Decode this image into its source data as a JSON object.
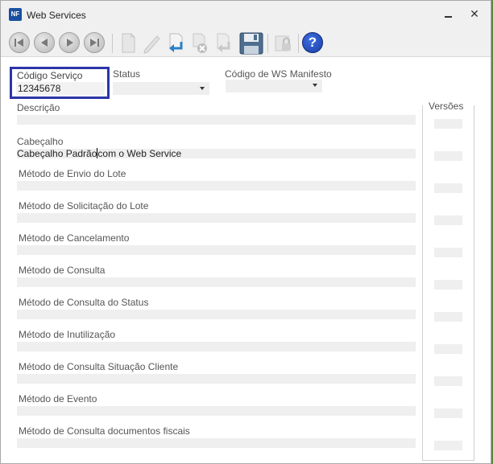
{
  "window": {
    "app_icon_text": "NF",
    "title": "Web Services",
    "minimize_label": "",
    "close_label": "✕"
  },
  "toolbar": {
    "buttons": [
      {
        "name": "first-record-button",
        "icon": "first-icon",
        "enabled": false
      },
      {
        "name": "previous-record-button",
        "icon": "previous-icon",
        "enabled": false
      },
      {
        "name": "next-record-button",
        "icon": "next-icon",
        "enabled": false
      },
      {
        "name": "last-record-button",
        "icon": "last-icon",
        "enabled": false
      },
      {
        "name": "new-button",
        "icon": "new-document-icon",
        "enabled": false
      },
      {
        "name": "edit-button",
        "icon": "pencil-icon",
        "enabled": false
      },
      {
        "name": "confirm-button",
        "icon": "confirm-arrow-icon",
        "enabled": true
      },
      {
        "name": "delete-button",
        "icon": "delete-icon",
        "enabled": false
      },
      {
        "name": "cancel-button",
        "icon": "cancel-arrow-icon",
        "enabled": false
      },
      {
        "name": "save-button",
        "icon": "floppy-disk-icon",
        "enabled": true
      },
      {
        "name": "lock-button",
        "icon": "lock-icon",
        "enabled": false
      },
      {
        "name": "help-button",
        "icon": "help-icon",
        "enabled": true
      }
    ],
    "help_glyph": "?"
  },
  "form": {
    "codigo_servico": {
      "label": "Código Serviço",
      "value": "12345678"
    },
    "status": {
      "label": "Status",
      "value": ""
    },
    "codigo_ws_manifesto": {
      "label": "Código de WS Manifesto",
      "value": ""
    },
    "descricao": {
      "label": "Descrição",
      "value": ""
    },
    "cabecalho": {
      "label": "Cabeçalho",
      "value_before_caret": "Cabeçalho Padrão",
      "value_after_caret": "com o Web Service"
    },
    "metodo_envio_lote": {
      "label": "Método de Envio do Lote",
      "value": ""
    },
    "metodo_solicitacao_lote": {
      "label": "Método de Solicitação do Lote",
      "value": ""
    },
    "metodo_cancelamento": {
      "label": "Método de Cancelamento",
      "value": ""
    },
    "metodo_consulta": {
      "label": "Método de Consulta",
      "value": ""
    },
    "metodo_consulta_status": {
      "label": "Método de Consulta do Status",
      "value": ""
    },
    "metodo_inutilizacao": {
      "label": "Método de Inutilização",
      "value": ""
    },
    "metodo_consulta_situacao_cliente": {
      "label": "Método de Consulta Situação Cliente",
      "value": ""
    },
    "metodo_evento": {
      "label": "Método de Evento",
      "value": ""
    },
    "metodo_consulta_documentos_fiscais": {
      "label": "Método de Consulta documentos fiscais",
      "value": ""
    }
  },
  "versoes": {
    "label": "Versões",
    "items": [
      "",
      "",
      "",
      "",
      "",
      "",
      "",
      "",
      "",
      "",
      ""
    ]
  },
  "colors": {
    "highlight_border": "#2c35a8",
    "field_bg": "#efefef",
    "help_blue": "#1a3ea8"
  }
}
